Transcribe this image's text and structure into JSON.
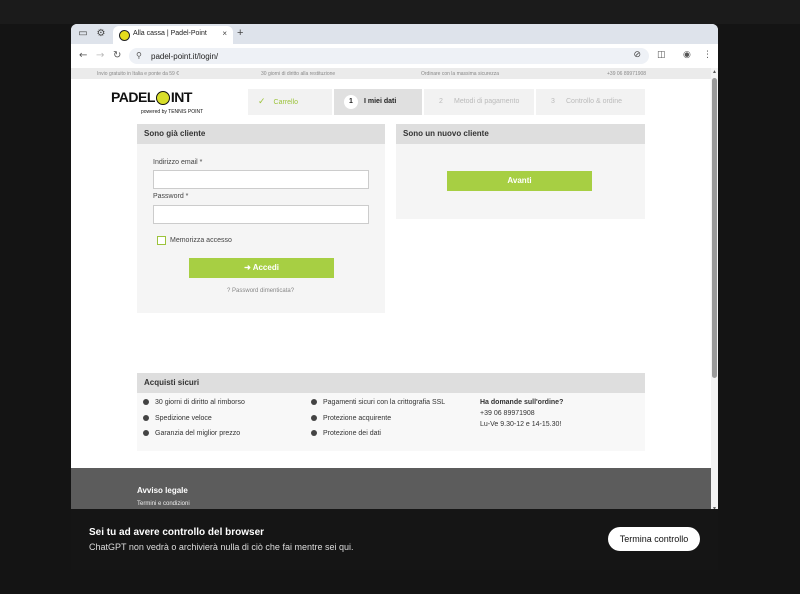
{
  "browser": {
    "tab_title": "Alla cassa | Padel-Point",
    "tab_close": "×",
    "new_tab": "+",
    "url": "padel-point.it/login/"
  },
  "promo_strip": [
    "Invio gratuito in Italia e ponte da 59 €",
    "30 giorni di diritto alla restituzione",
    "Ordinare con la massima sicurezza",
    "+39 06 89971908"
  ],
  "logo": {
    "main_left": "PADEL",
    "main_right": "INT",
    "sub": "powered by TENNIS POINT"
  },
  "steps": [
    {
      "label": "Carrello",
      "num": ""
    },
    {
      "label": "I miei dati",
      "num": "1"
    },
    {
      "label": "Metodi di pagamento",
      "num": "2"
    },
    {
      "label": "Controllo & ordine",
      "num": "3"
    }
  ],
  "login": {
    "heading": "Sono già cliente",
    "email_label": "Indirizzo email *",
    "email_value": "",
    "password_label": "Password *",
    "password_value": "",
    "remember_label": "Memorizza accesso",
    "submit_label": "Accedi",
    "forgot_label": "Password dimenticata?"
  },
  "new_customer": {
    "heading": "Sono un nuovo cliente",
    "button_label": "Avanti"
  },
  "secure": {
    "heading": "Acquisti sicuri",
    "col1": [
      "30 giorni di diritto al rimborso",
      "Spedizione veloce",
      "Garanzia del miglior prezzo"
    ],
    "col2": [
      "Pagamenti sicuri con la crittografia SSL",
      "Protezione acquirente",
      "Protezione dei dati"
    ],
    "contact_title": "Ha domande sull'ordine?",
    "contact_phone": "+39 06 89971908",
    "contact_hours": "Lu-Ve 9.30-12 e 14-15.30!"
  },
  "footer": {
    "title": "Avviso legale",
    "link": "Termini e condizioni"
  },
  "overlay": {
    "title": "Sei tu ad avere controllo del browser",
    "subtitle": "ChatGPT non vedrà o archivierà nulla di ciò che fai mentre sei qui.",
    "button": "Termina controllo"
  },
  "colors": {
    "accent_green": "#a7cf43",
    "footer_gray": "#5c5c5c"
  }
}
